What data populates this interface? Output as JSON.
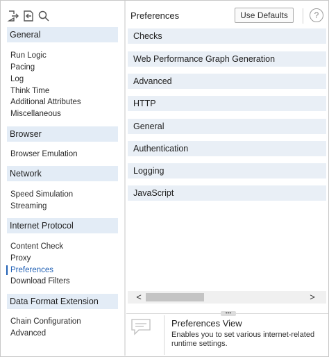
{
  "sidebar": {
    "icons": [
      "export-icon",
      "import-icon",
      "search-icon"
    ],
    "groups": [
      {
        "label": "General",
        "items": [
          "Run Logic",
          "Pacing",
          "Log",
          "Think Time",
          "Additional Attributes",
          "Miscellaneous"
        ]
      },
      {
        "label": "Browser",
        "items": [
          "Browser Emulation"
        ]
      },
      {
        "label": "Network",
        "items": [
          "Speed Simulation",
          "Streaming"
        ]
      },
      {
        "label": "Internet Protocol",
        "items": [
          "Content Check",
          "Proxy",
          "Preferences",
          "Download Filters"
        ]
      },
      {
        "label": "Data Format Extension",
        "items": [
          "Chain Configuration",
          "Advanced"
        ]
      }
    ],
    "active_item": "Preferences",
    "accent_color": "#1f5fb4"
  },
  "main": {
    "title": "Preferences",
    "use_defaults_label": "Use Defaults",
    "help_label": "?",
    "sections": [
      "Checks",
      "Web Performance Graph Generation",
      "Advanced",
      "HTTP",
      "General",
      "Authentication",
      "Logging",
      "JavaScript"
    ],
    "scroll_left": "<",
    "scroll_right": ">"
  },
  "info": {
    "title": "Preferences View",
    "description": "Enables you to set various internet-related runtime settings."
  }
}
